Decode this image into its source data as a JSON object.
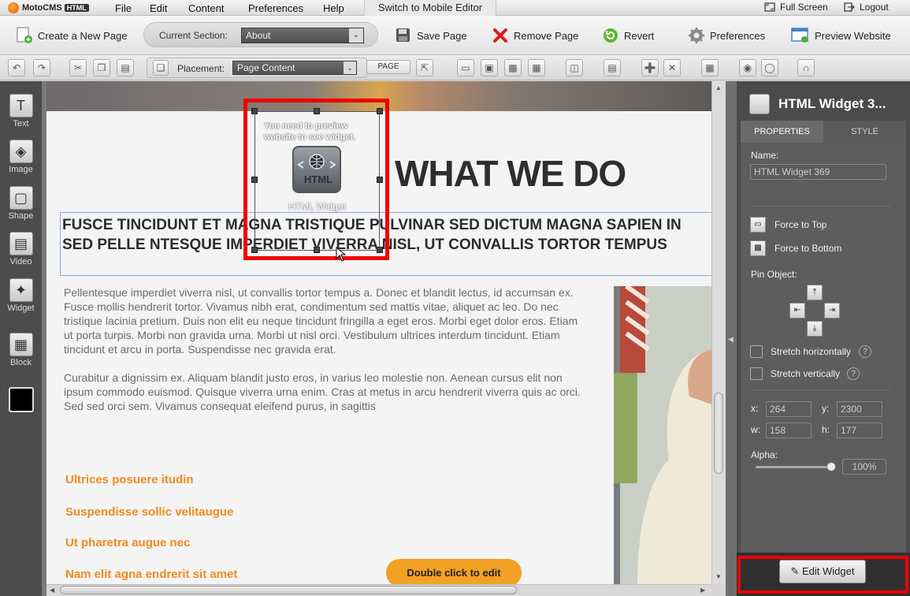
{
  "app": {
    "name": "MotoCMS",
    "badge": "HTML"
  },
  "menu": [
    "File",
    "Edit",
    "Content",
    "Preferences",
    "Help"
  ],
  "mobile_editor": "Switch to Mobile Editor",
  "top_right": {
    "fullscreen": "Full Screen",
    "logout": "Logout"
  },
  "toolbar": {
    "create_page": "Create a New Page",
    "current_section_label": "Current Section:",
    "current_section_value": "About",
    "save_page": "Save Page",
    "remove_page": "Remove Page",
    "revert": "Revert",
    "preferences": "Preferences",
    "preview": "Preview Website"
  },
  "toolbar2": {
    "placement_label": "Placement:",
    "placement_value": "Page Content",
    "page_button": "PAGE"
  },
  "tools": [
    {
      "label": "Text",
      "icon": "text-tool-icon"
    },
    {
      "label": "Image",
      "icon": "image-tool-icon"
    },
    {
      "label": "Shape",
      "icon": "shape-tool-icon"
    },
    {
      "label": "Video",
      "icon": "video-tool-icon"
    },
    {
      "label": "Widget",
      "icon": "widget-tool-icon"
    },
    {
      "label": "Block",
      "icon": "block-tool-icon"
    }
  ],
  "canvas": {
    "heading": "WHAT WE DO",
    "subhead": "FUSCE TINCIDUNT ET MAGNA TRISTIQUE PULVINAR SED DICTUM MAGNA SAPIEN IN SED PELLE NTESQUE IMPERDIET VIVERRA NISL, UT CONVALLIS TORTOR TEMPUS",
    "para1": "Pellentesque imperdiet viverra nisl, ut convallis tortor tempus a. Donec et blandit lectus, id accumsan ex. Fusce mollis hendrerit tortor. Vivamus nibh erat, condimentum sed mattis vitae, aliquet ac leo. Do nec tristique lacinia pretium. Duis non elit eu neque tincidunt fringilla a eget eros. Morbi eget dolor eros. Etiam ut porta turpis. Morbi non gravida urna. Morbi ut nisl orci. Vestibulum ultrices interdum tincidunt. Etiam tincidunt et arcu in porta. Suspendisse nec gravida erat.",
    "para2": "Curabitur a dignissim ex. Aliquam blandit justo eros, in varius leo molestie non. Aenean cursus elit non ipsum commodo euismod. Quisque viverra urna enim. Cras at metus in arcu hendrerit viverra quis ac orci. Sed sed orci sem. Vivamus consequat eleifend purus, in sagittis",
    "links": [
      "Ultrices posuere itudin",
      "Suspendisse sollic velitaugue",
      "Ut pharetra augue nec",
      "Nam elit agna endrerit sit amet"
    ],
    "widget_message": "You need to preview website to see widget.",
    "widget_icon_text": "HTML",
    "widget_label": "HTML Widget",
    "double_click": "Double click to edit"
  },
  "panel": {
    "title": "HTML Widget 3...",
    "tabs": [
      "PROPERTIES",
      "STYLE"
    ],
    "name_label": "Name:",
    "name_value": "HTML Widget 369",
    "force_top": "Force to Top",
    "force_bottom": "Force to Bottom",
    "pin_label": "Pin Object:",
    "stretch_h": "Stretch horizontally",
    "stretch_v": "Stretch vertically",
    "x_label": "x:",
    "x_value": "264",
    "y_label": "y:",
    "y_value": "2300",
    "w_label": "w:",
    "w_value": "158",
    "h_label": "h:",
    "h_value": "177",
    "alpha_label": "Alpha:",
    "alpha_value": "100%",
    "alpha_fraction": 1.0,
    "edit_widget": "Edit Widget",
    "help_glyph": "?"
  },
  "colors": {
    "accent_orange": "#f08a1c",
    "highlight_red": "#ee0000",
    "panel_bg": "#4b4b4b"
  }
}
